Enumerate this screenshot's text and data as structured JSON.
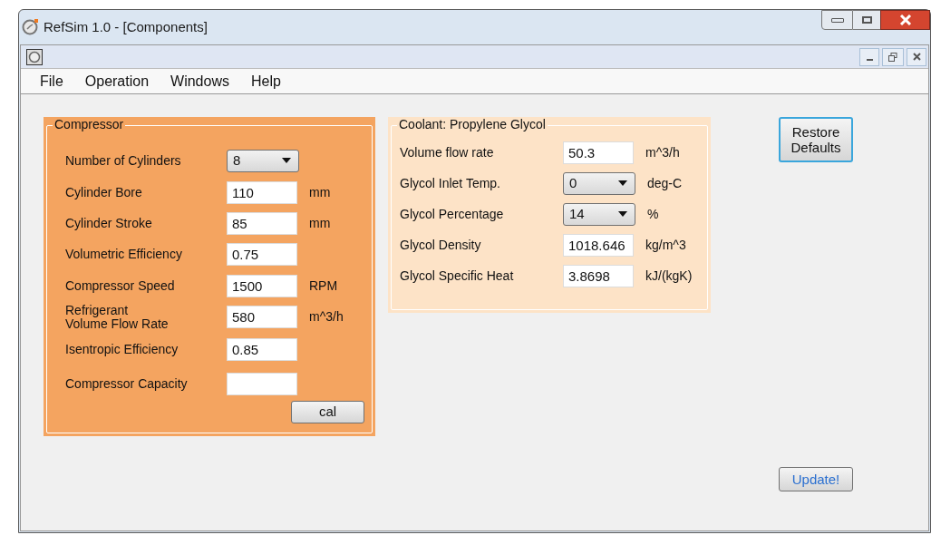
{
  "window": {
    "title": "RefSim 1.0 - [Components]"
  },
  "menu": [
    "File",
    "Operation",
    "Windows",
    "Help"
  ],
  "compressor": {
    "title": "Compressor",
    "fields": [
      {
        "label": "Number of Cylinders",
        "kind": "select",
        "value": "8"
      },
      {
        "label": "Cylinder Bore",
        "kind": "text",
        "value": "110",
        "unit": "mm"
      },
      {
        "label": "Cylinder Stroke",
        "kind": "text",
        "value": "85",
        "unit": "mm"
      },
      {
        "label": "Volumetric Efficiency",
        "kind": "text",
        "value": "0.75"
      },
      {
        "label": "Compressor Speed",
        "kind": "text",
        "value": "1500",
        "unit": "RPM"
      },
      {
        "label": "Refrigerant\nVolume Flow Rate",
        "kind": "text",
        "value": "580",
        "unit": "m^3/h"
      },
      {
        "label": "Isentropic Efficiency",
        "kind": "text",
        "value": "0.85"
      },
      {
        "label": "Compressor Capacity",
        "kind": "text"
      }
    ],
    "button": "cal"
  },
  "coolant": {
    "title": "Coolant: Propylene Glycol",
    "fields": [
      {
        "label": "Volume flow rate",
        "kind": "text",
        "value": "50.3",
        "unit": "m^3/h"
      },
      {
        "label": "Glycol Inlet Temp.",
        "kind": "select",
        "value": "0",
        "unit": "deg-C"
      },
      {
        "label": "Glycol Percentage",
        "kind": "select",
        "value": "14",
        "unit": "%"
      },
      {
        "label": "Glycol Density",
        "kind": "text",
        "value": "1018.646",
        "unit": "kg/m^3"
      },
      {
        "label": "Glycol Specific Heat",
        "kind": "text",
        "value": "3.8698",
        "unit": "kJ/(kgK)"
      }
    ]
  },
  "buttons": [
    {
      "label": "Restore\nDefaults",
      "focused": true
    },
    {
      "label": "Update!",
      "focused": false
    }
  ]
}
